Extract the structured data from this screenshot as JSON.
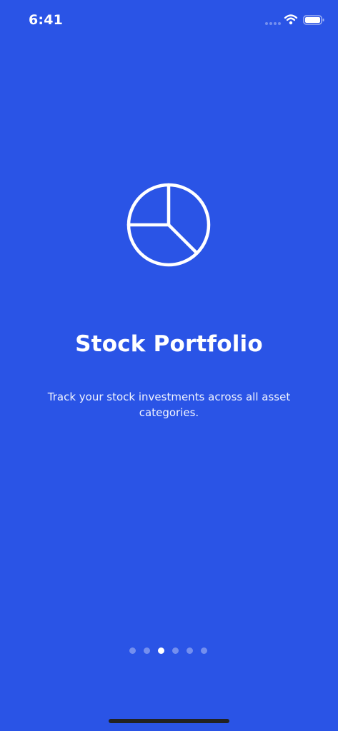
{
  "status_bar": {
    "time": "6:41"
  },
  "onboarding": {
    "icon": "pie-chart-icon",
    "title": "Stock Portfolio",
    "description": "Track your stock investments across all asset categories.",
    "page_count": 6,
    "active_page": 3
  },
  "colors": {
    "background": "#2a54e6",
    "text": "#ffffff",
    "inactive_dot": "rgba(255,255,255,0.35)",
    "home_indicator": "#222222"
  }
}
